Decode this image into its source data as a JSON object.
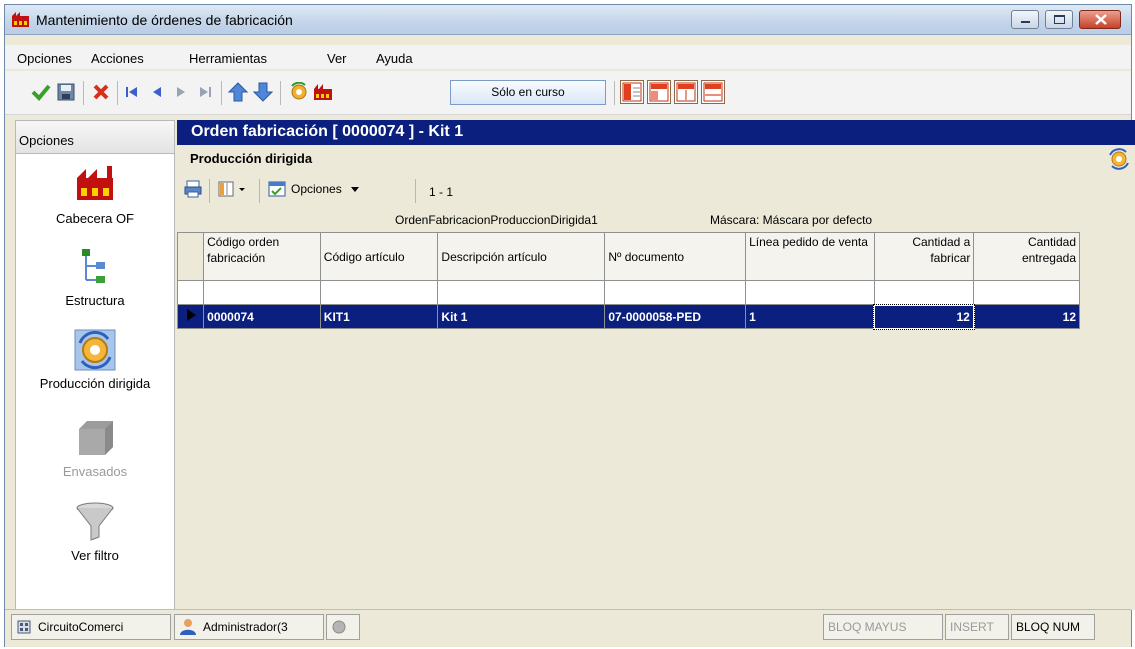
{
  "window": {
    "title": "Mantenimiento de órdenes de fabricación"
  },
  "menu": [
    {
      "label": "Opciones"
    },
    {
      "label": "Acciones"
    },
    {
      "label": "Herramientas"
    },
    {
      "label": "Ver"
    },
    {
      "label": "Ayuda"
    }
  ],
  "toolbar": {
    "filter_label": "Sólo en curso",
    "icons": [
      "check-icon",
      "save-icon",
      "delete-icon",
      "first-record-icon",
      "previous-record-icon",
      "next-record-icon",
      "last-record-icon",
      "move-up-icon",
      "move-down-icon",
      "process-icon",
      "factory-icon"
    ]
  },
  "sidebar": {
    "header": "Opciones",
    "items": [
      {
        "label": "Cabecera OF",
        "icon": "factory-icon"
      },
      {
        "label": "Estructura",
        "icon": "tree-structure-icon"
      },
      {
        "label": "Producción dirigida",
        "icon": "gear-refresh-icon"
      },
      {
        "label": "Envasados",
        "icon": "box-icon",
        "disabled": true
      },
      {
        "label": "Ver filtro",
        "icon": "funnel-icon"
      }
    ]
  },
  "document": {
    "title": "Orden fabricación   [ 0000074 ] - Kit 1",
    "section": "Producción dirigida"
  },
  "grid_toolbar": {
    "options_label": "Opciones",
    "range": "1 - 1"
  },
  "grid": {
    "caption": "OrdenFabricacionProduccionDirigida1",
    "mask": "Máscara: Máscara por defecto",
    "columns": [
      "Código orden fabricación",
      "Código artículo",
      "Descripción artículo",
      "Nº documento",
      "Línea pedido de venta",
      "Cantidad a fabricar",
      "Cantidad entregada"
    ],
    "rows": [
      [
        "0000074",
        "KIT1",
        "Kit 1",
        "07-0000058-PED",
        "1",
        "12",
        "12"
      ]
    ]
  },
  "status": {
    "circuit": "CircuitoComerci",
    "user": "Administrador(3",
    "caps": "BLOQ MAYUS",
    "insert": "INSERT",
    "num": "BLOQ NUM"
  },
  "colors": {
    "selection": "#0a1f7e",
    "chrome": "#ece9d8"
  }
}
